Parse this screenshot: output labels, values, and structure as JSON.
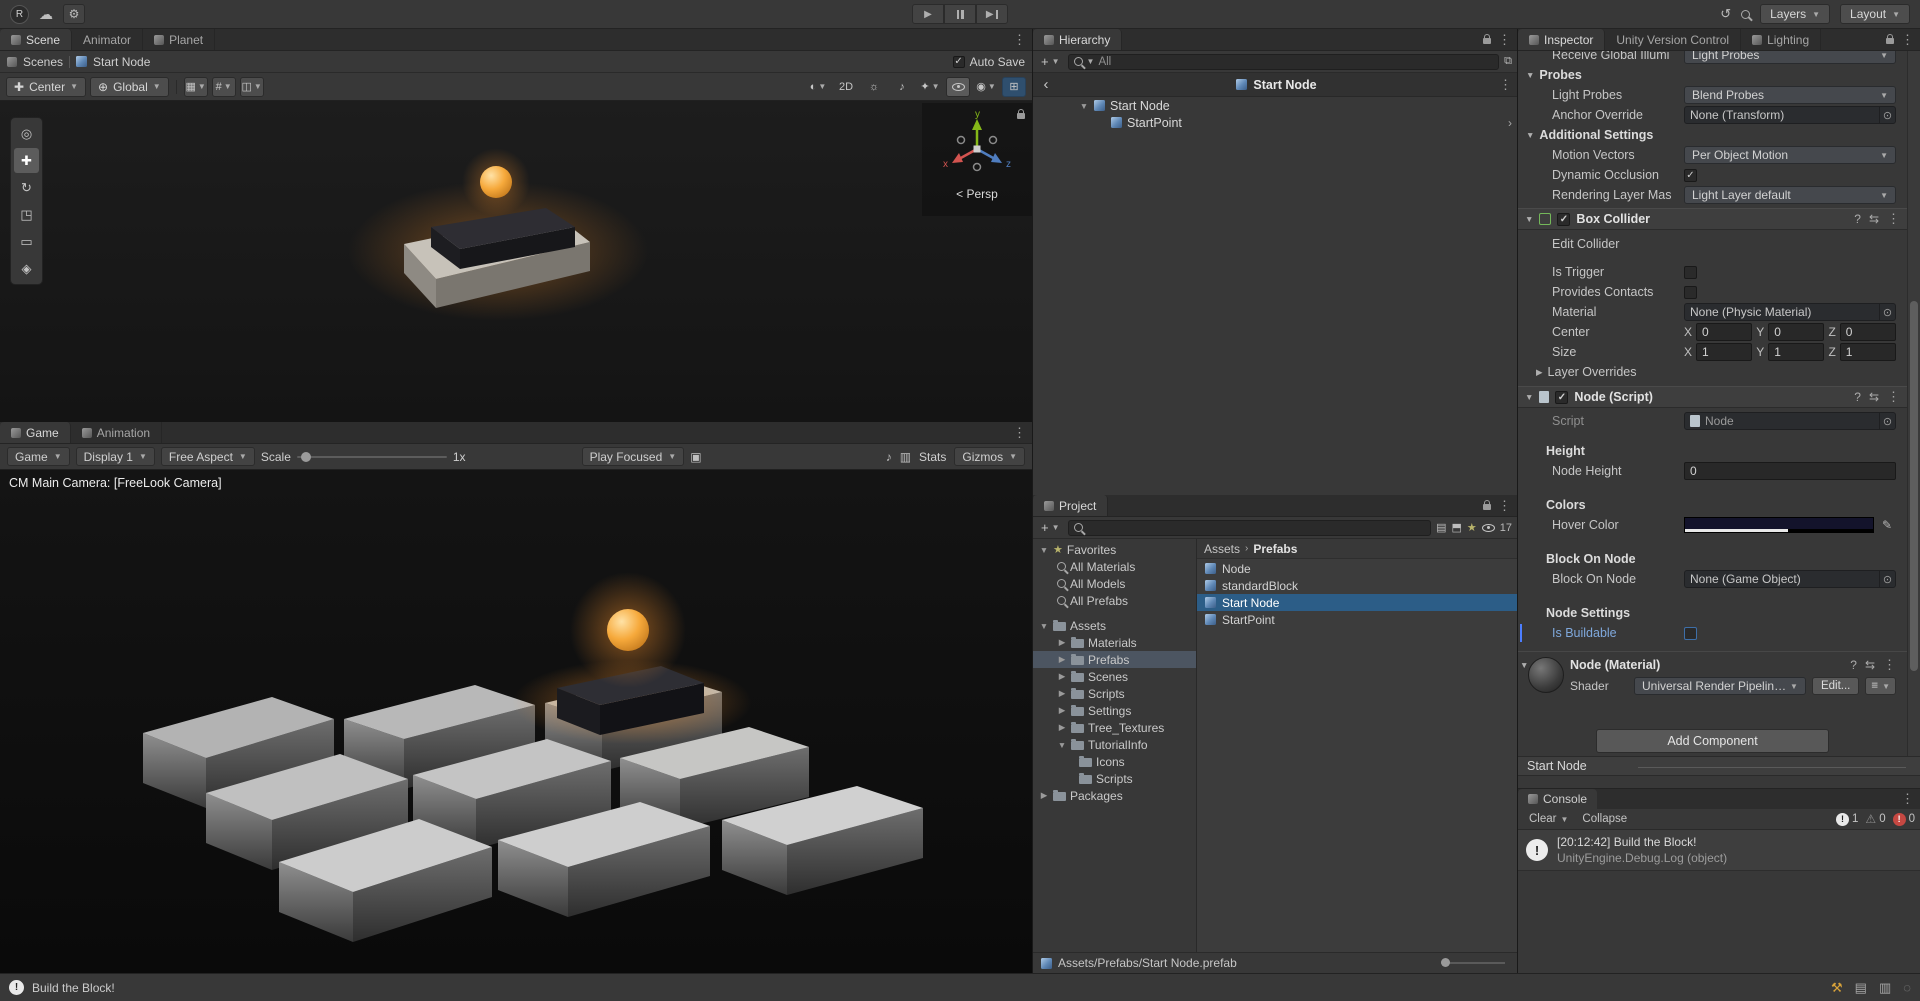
{
  "topbar": {
    "account_label": "R",
    "layers_label": "Layers",
    "layout_label": "Layout"
  },
  "scene": {
    "tabs": [
      {
        "label": "Scene"
      },
      {
        "label": "Animator"
      },
      {
        "label": "Planet"
      }
    ],
    "breadcrumb": {
      "root": "Scenes",
      "current": "Start Node"
    },
    "auto_save_label": "Auto Save",
    "toolbar": {
      "pivot_label": "Center",
      "orientation_label": "Global",
      "mode_2d_label": "2D"
    },
    "gizmo": {
      "x": "x",
      "y": "y",
      "z": "z",
      "persp_label": "< Persp"
    }
  },
  "game": {
    "tabs": [
      {
        "label": "Game"
      },
      {
        "label": "Animation"
      }
    ],
    "toolbar": {
      "view_label": "Game",
      "display_label": "Display 1",
      "aspect_label": "Free Aspect",
      "scale_label": "Scale",
      "scale_value": "1x",
      "focus_label": "Play Focused",
      "stats_label": "Stats",
      "gizmos_label": "Gizmos"
    },
    "camera_overlay": "CM Main Camera: [FreeLook Camera]"
  },
  "hierarchy": {
    "title": "Hierarchy",
    "search_filter": "All",
    "prefab_header": "Start Node",
    "items": [
      {
        "label": "Start Node"
      },
      {
        "label": "StartPoint"
      }
    ]
  },
  "project": {
    "title": "Project",
    "favorites_label": "Favorites",
    "favorites": [
      {
        "label": "All Materials"
      },
      {
        "label": "All Models"
      },
      {
        "label": "All Prefabs"
      }
    ],
    "assets_label": "Assets",
    "folders": [
      {
        "label": "Materials"
      },
      {
        "label": "Prefabs"
      },
      {
        "label": "Scenes"
      },
      {
        "label": "Scripts"
      },
      {
        "label": "Settings"
      },
      {
        "label": "Tree_Textures"
      },
      {
        "label": "TutorialInfo"
      },
      {
        "label": "Icons"
      },
      {
        "label": "Scripts"
      }
    ],
    "packages_label": "Packages",
    "breadcrumb": {
      "root": "Assets",
      "current": "Prefabs"
    },
    "files": [
      {
        "label": "Node"
      },
      {
        "label": "standardBlock"
      },
      {
        "label": "Start Node"
      },
      {
        "label": "StartPoint"
      }
    ],
    "footer_path": "Assets/Prefabs/Start Node.prefab",
    "hidden_count": "17"
  },
  "inspector": {
    "tabs": [
      {
        "label": "Inspector"
      },
      {
        "label": "Unity Version Control"
      },
      {
        "label": "Lighting"
      }
    ],
    "clipped_row": {
      "label": "Receive Global Illumi",
      "value": "Light Probes"
    },
    "probes": {
      "title": "Probes",
      "light_probes_label": "Light Probes",
      "light_probes_value": "Blend Probes",
      "anchor_label": "Anchor Override",
      "anchor_value": "None (Transform)"
    },
    "additional": {
      "title": "Additional Settings",
      "motion_label": "Motion Vectors",
      "motion_value": "Per Object Motion",
      "occlusion_label": "Dynamic Occlusion",
      "layer_mask_label": "Rendering Layer Mas",
      "layer_mask_value": "Light Layer default"
    },
    "box_collider": {
      "title": "Box Collider",
      "edit_label": "Edit Collider",
      "trigger_label": "Is Trigger",
      "contacts_label": "Provides Contacts",
      "material_label": "Material",
      "material_value": "None (Physic Material)",
      "center_label": "Center",
      "size_label": "Size",
      "axis_labels": {
        "x": "X",
        "y": "Y",
        "z": "Z"
      },
      "center": {
        "x": "0",
        "y": "0",
        "z": "0"
      },
      "size": {
        "x": "1",
        "y": "1",
        "z": "1"
      },
      "layer_overrides_label": "Layer Overrides"
    },
    "node_script": {
      "title": "Node (Script)",
      "script_label": "Script",
      "script_value": "Node",
      "height_section": "Height",
      "node_height_label": "Node Height",
      "node_height_value": "0",
      "colors_section": "Colors",
      "hover_color_label": "Hover Color",
      "block_section": "Block On Node",
      "block_label": "Block On Node",
      "block_value": "None (Game Object)",
      "settings_section": "Node Settings",
      "buildable_label": "Is Buildable"
    },
    "material": {
      "title": "Node (Material)",
      "shader_label": "Shader",
      "shader_value": "Universal Render Pipeline/Lit",
      "edit_label": "Edit..."
    },
    "add_component_label": "Add Component",
    "preview_header": "Start Node"
  },
  "console": {
    "title": "Console",
    "clear_label": "Clear",
    "collapse_label": "Collapse",
    "info_count": "1",
    "warning_count": "0",
    "error_count": "0",
    "entry_line1": "[20:12:42] Build the Block!",
    "entry_line2": "UnityEngine.Debug.Log (object)"
  },
  "statusbar": {
    "message": "Build the Block!"
  },
  "colors": {
    "selection_blue": "#2C5D87",
    "accent_orange": "#F6A93B"
  }
}
